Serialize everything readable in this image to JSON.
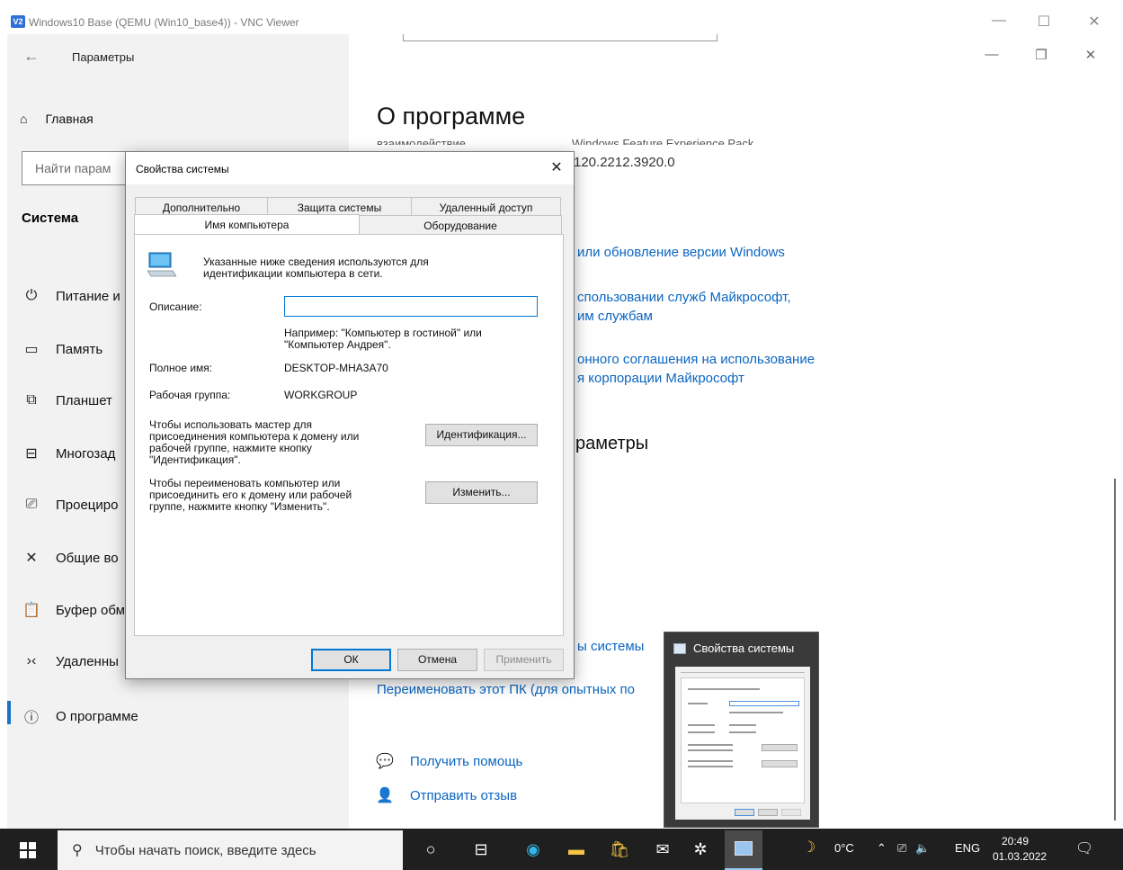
{
  "vnc": {
    "logo": "V2",
    "title": "Windows10 Base (QEMU (Win10_base4)) - VNC Viewer"
  },
  "settings": {
    "title": "Параметры",
    "home_label": "Главная",
    "search_placeholder": "Найти парам",
    "section": "Система",
    "sidebar_items": [
      {
        "label": "Питание и",
        "icon": "power-icon"
      },
      {
        "label": "Память",
        "icon": "storage-icon"
      },
      {
        "label": "Планшет",
        "icon": "tablet-icon"
      },
      {
        "label": "Многозад",
        "icon": "multitasking-icon"
      },
      {
        "label": "Проециро",
        "icon": "projecting-icon"
      },
      {
        "label": "Общие во",
        "icon": "shared-icon"
      },
      {
        "label": "Буфер обм",
        "icon": "clipboard-icon"
      },
      {
        "label": "Удаленны",
        "icon": "remote-desktop-icon"
      },
      {
        "label": "О программе",
        "icon": "info-icon"
      }
    ],
    "main": {
      "heading": "О программе",
      "faded_left": "взаимодействие",
      "faded_right": "Windows Feature Experience Pack",
      "version_text": "120.2212.3920.0",
      "link1": "или обновление версии Windows",
      "link2_line1": "спользовании служб Майкрософт,",
      "link2_line2": "им службам",
      "link3_line1": "онного соглашения на использование",
      "link3_line2": "я корпорации Майкрософт",
      "sub_heading": "раметры",
      "link4": "ы системы",
      "link5": "Переименовать этот ПК (для опытных по",
      "help": "Получить помощь",
      "feedback": "Отправить отзыв"
    }
  },
  "dialog": {
    "title": "Свойства системы",
    "tabs_top": [
      "Дополнительно",
      "Защита системы",
      "Удаленный доступ"
    ],
    "tabs_bottom": [
      "Имя компьютера",
      "Оборудование"
    ],
    "intro_line1": "Указанные ниже сведения используются для",
    "intro_line2": "идентификации компьютера в сети.",
    "description_label": "Описание:",
    "description_value": "",
    "example_line1": "Например: \"Компьютер в гостиной\" или",
    "example_line2": "\"Компьютер Андрея\".",
    "fullname_label": "Полное имя:",
    "fullname_value": "DESKTOP-MHA3A70",
    "workgroup_label": "Рабочая группа:",
    "workgroup_value": "WORKGROUP",
    "wizard_text": [
      "Чтобы использовать мастер для",
      "присоединения компьютера к домену или",
      "рабочей группе, нажмите кнопку",
      "\"Идентификация\"."
    ],
    "rename_text": [
      "Чтобы переименовать компьютер или",
      "присоединить его к домену или рабочей",
      "группе, нажмите кнопку \"Изменить\"."
    ],
    "identify_button": "Идентификация...",
    "change_button": "Изменить...",
    "ok_button": "ОК",
    "cancel_button": "Отмена",
    "apply_button": "Применить"
  },
  "thumbnail": {
    "title": "Свойства системы"
  },
  "taskbar": {
    "search_placeholder": "Чтобы начать поиск, введите здесь",
    "temperature": "0°C",
    "language": "ENG",
    "time": "20:49",
    "date": "01.03.2022"
  }
}
